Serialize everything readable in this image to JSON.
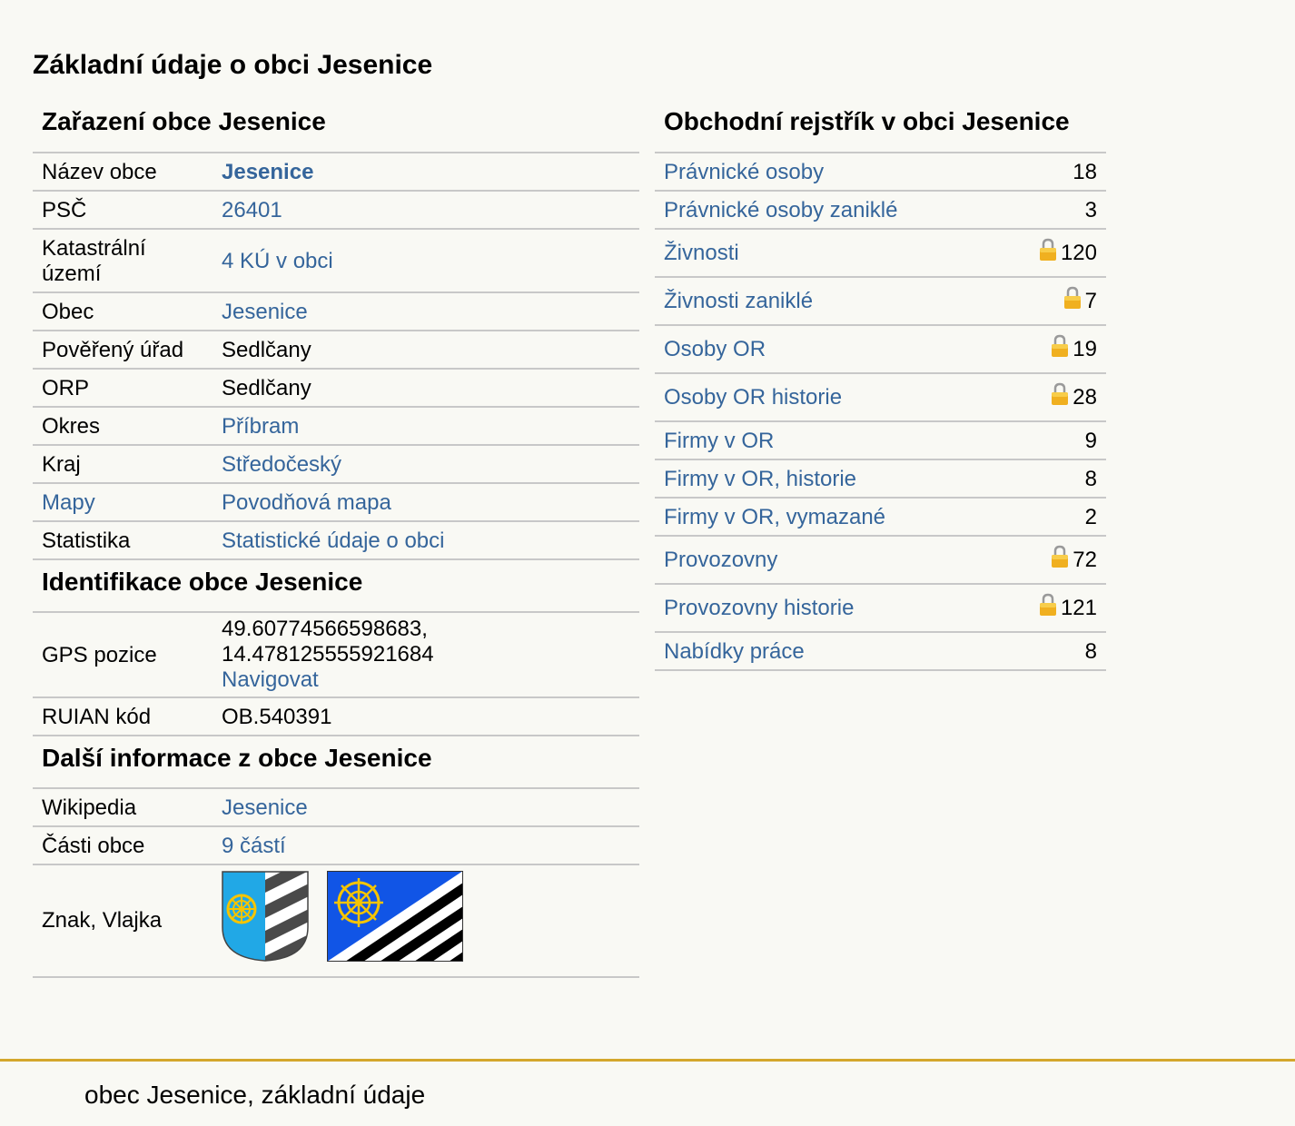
{
  "page_title": "Základní údaje o obci Jesenice",
  "zarazeni": {
    "title": "Zařazení obce Jesenice",
    "rows": [
      {
        "key": "Název obce",
        "value": "Jesenice",
        "link": true,
        "bold": true
      },
      {
        "key": "PSČ",
        "value": "26401",
        "link": true
      },
      {
        "key": "Katastrální území",
        "value": "4 KÚ v obci",
        "link": true
      },
      {
        "key": "Obec",
        "value": "Jesenice",
        "link": true
      },
      {
        "key": "Pověřený úřad",
        "value": "Sedlčany",
        "link": false
      },
      {
        "key": "ORP",
        "value": "Sedlčany",
        "link": false
      },
      {
        "key": "Okres",
        "value": "Příbram",
        "link": true
      },
      {
        "key": "Kraj",
        "value": "Středočeský",
        "link": true
      },
      {
        "key": "Mapy",
        "key_link": true,
        "value": "Povodňová mapa",
        "link": true
      },
      {
        "key": "Statistika",
        "value": "Statistické údaje o obci",
        "link": true
      }
    ]
  },
  "identifikace": {
    "title": "Identifikace obce Jesenice",
    "gps_key": "GPS pozice",
    "gps_line1": "49.60774566598683,",
    "gps_line2": "14.478125555921684",
    "navigate": "Navigovat",
    "ruian_key": "RUIAN kód",
    "ruian_value": "OB.540391"
  },
  "dalsi": {
    "title": "Další informace z obce Jesenice",
    "wiki_key": "Wikipedia",
    "wiki_value": "Jesenice",
    "parts_key": "Části obce",
    "parts_value": "9 částí",
    "emblem_key": "Znak, Vlajka"
  },
  "rejstrik": {
    "title": "Obchodní rejstřík v obci Jesenice",
    "rows": [
      {
        "label": "Právnické osoby",
        "count": "18",
        "locked": false
      },
      {
        "label": "Právnické osoby zaniklé",
        "count": "3",
        "locked": false
      },
      {
        "label": "Živnosti",
        "count": "120",
        "locked": true
      },
      {
        "label": "Živnosti zaniklé",
        "count": "7",
        "locked": true
      },
      {
        "label": "Osoby OR",
        "count": "19",
        "locked": true
      },
      {
        "label": "Osoby OR historie",
        "count": "28",
        "locked": true
      },
      {
        "label": "Firmy v OR",
        "count": "9",
        "locked": false
      },
      {
        "label": "Firmy v OR, historie",
        "count": "8",
        "locked": false
      },
      {
        "label": "Firmy v OR, vymazané",
        "count": "2",
        "locked": false
      },
      {
        "label": "Provozovny",
        "count": "72",
        "locked": true
      },
      {
        "label": "Provozovny historie",
        "count": "121",
        "locked": true
      },
      {
        "label": "Nabídky práce",
        "count": "8",
        "locked": false
      }
    ]
  },
  "colors": {
    "link": "#35659b",
    "footer_accent": "#d4a72c",
    "border": "#c8c8c8"
  },
  "footer": "obec Jesenice, základní údaje"
}
